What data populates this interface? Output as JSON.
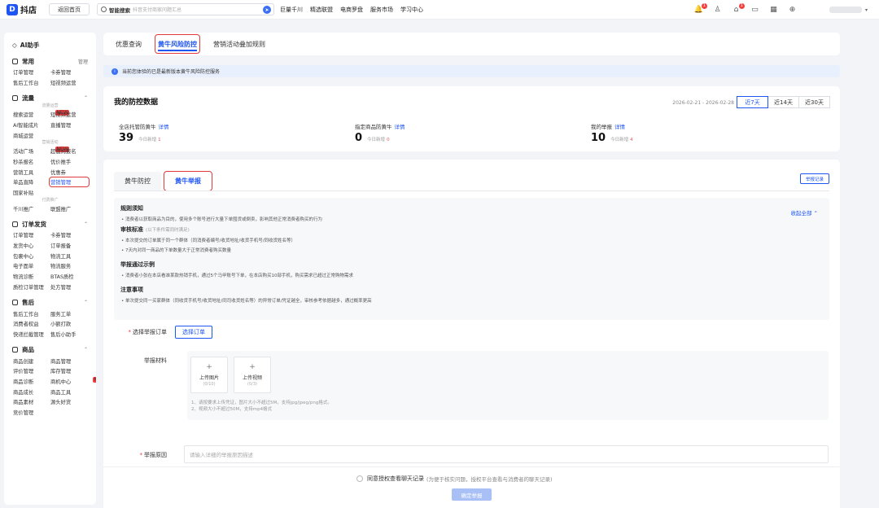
{
  "app": {
    "logo_mark": "D",
    "logo_text": "抖店",
    "home_button": "返回首页"
  },
  "search": {
    "label": "智能搜索",
    "placeholder": "抖音支付商家问题汇总"
  },
  "topnav": [
    "巨量千川",
    "精选联盟",
    "电商罗盘",
    "服务市场",
    "学习中心"
  ],
  "top_badges": {
    "bell": "1",
    "shop": "1"
  },
  "sidebar": {
    "ai_label": "AI助手",
    "sections": [
      {
        "title": "常用",
        "right": "管理",
        "groups": [
          {
            "sub": "",
            "rows": [
              [
                "订单管理",
                "卡券管理"
              ],
              [
                "售后工作台",
                "短视频运营"
              ]
            ]
          }
        ]
      },
      {
        "title": "流量",
        "right": "",
        "groups": [
          {
            "sub": "流量运营",
            "rows": [
              [
                "搜索运营",
                "短视频运营"
              ],
              [
                "AI智能成片",
                "直播管理"
              ],
              [
                "商城运营",
                ""
              ]
            ]
          },
          {
            "sub": "营销活动",
            "rows": [
              [
                "活动广场",
                "超值购报名"
              ],
              [
                "秒杀报名",
                "优价推手"
              ],
              [
                "营销工具",
                "优惠券"
              ],
              [
                "单品直降",
                "营销管理"
              ],
              [
                "国家补贴",
                ""
              ]
            ]
          },
          {
            "sub": "付费推广",
            "rows": [
              [
                "千川推广",
                "联盟推广"
              ]
            ]
          }
        ]
      },
      {
        "title": "订单发货",
        "right": "",
        "groups": [
          {
            "sub": "",
            "rows": [
              [
                "订单管理",
                "卡券管理"
              ],
              [
                "发货中心",
                "订单报备"
              ],
              [
                "包裹中心",
                "物流工具"
              ],
              [
                "电子面单",
                "物流服务"
              ],
              [
                "物流诊断",
                "BTAS质检"
              ],
              [
                "质检订单管理",
                "处方管理"
              ]
            ]
          }
        ]
      },
      {
        "title": "售后",
        "right": "",
        "groups": [
          {
            "sub": "",
            "rows": [
              [
                "售后工作台",
                "服务工单"
              ],
              [
                "消费者权益",
                "小额打款"
              ],
              [
                "快递拦截管理",
                "售后小助手"
              ]
            ]
          }
        ]
      },
      {
        "title": "商品",
        "right": "",
        "groups": [
          {
            "sub": "",
            "rows": [
              [
                "商品创建",
                "商品管理"
              ],
              [
                "评价管理",
                "库存管理"
              ],
              [
                "商品诊断",
                "商机中心"
              ],
              [
                "商品成长",
                "商品工具"
              ],
              [
                "商品素材",
                "源头好货"
              ],
              [
                "竞价管理",
                ""
              ]
            ]
          }
        ]
      }
    ],
    "new_badge": "NEW",
    "highlighted": "营销管理"
  },
  "tabs": [
    "优惠查询",
    "黄牛风险防控",
    "营销活动叠加规则"
  ],
  "notice": "当前您体验的已是最新版本黄牛风险防控服务",
  "data_card": {
    "title": "我的防控数据",
    "date_range": "2026-02-21 - 2026-02-28",
    "periods": [
      "近7天",
      "近14天",
      "近30天"
    ],
    "active_period": "近7天",
    "stats": [
      {
        "label": "全店托管防黄牛",
        "link": "详情",
        "value": "39",
        "sub": "今日新增",
        "sub_value": "1"
      },
      {
        "label": "指定商品防黄牛",
        "link": "详情",
        "value": "0",
        "sub": "今日新增",
        "sub_value": "0"
      },
      {
        "label": "我的举报",
        "link": "详情",
        "value": "10",
        "sub": "今日新增",
        "sub_value": "4"
      }
    ]
  },
  "report": {
    "tabs": [
      "黄牛防控",
      "黄牛举报"
    ],
    "record_button": "举报记录",
    "collapse": "收起全部",
    "rules": [
      {
        "title": "规则须知",
        "note": "",
        "lines": [
          "消费者以获取商品为目的，使用多个账号进行大量下单囤货或倒卖，影响其他正常消费者购买的行为"
        ]
      },
      {
        "title": "审核标准",
        "note": "(以下条件需同时满足)",
        "lines": [
          "本次提交的订单属于同一个群体（同消费者编号/收货地址/收货手机号/同收货姓名等）",
          "7天内对同一商品的下单数量大于正常消费者购买数量"
        ]
      },
      {
        "title": "举报通过示例",
        "note": "",
        "lines": [
          "消费者小张在本店看准某款热销手机，通过5个马甲账号下单，在本店购买10部手机，购买需求已超过正常购物需求"
        ]
      },
      {
        "title": "注意事项",
        "note": "",
        "lines": [
          "单次提交同一买家群体（同收货手机号/收货地址/同司收货姓名等）的异常订单/凭证越全，审核参考依据越多，通过概率更高"
        ]
      }
    ],
    "order_label": "选择举报订单",
    "order_button": "选择订单",
    "material_label": "举报材料",
    "upload": [
      {
        "title": "上传图片",
        "count": "(0/10)"
      },
      {
        "title": "上传视频",
        "count": "(0/3)"
      }
    ],
    "upload_hints": [
      "1、请按要求上传凭证，图片大小不超过5M，支持jpg/jpeg/png格式。",
      "2、视频大小不超过50M，支持mp4格式"
    ],
    "reason_label": "举报原因",
    "reason_placeholder": "请输入详细的举报原因描述"
  },
  "footer": {
    "agree": "同意授权查看聊天记录",
    "agree_note": "(为便于核实问题，授权平台查看与消费者的聊天记录)",
    "submit": "确定举报"
  }
}
